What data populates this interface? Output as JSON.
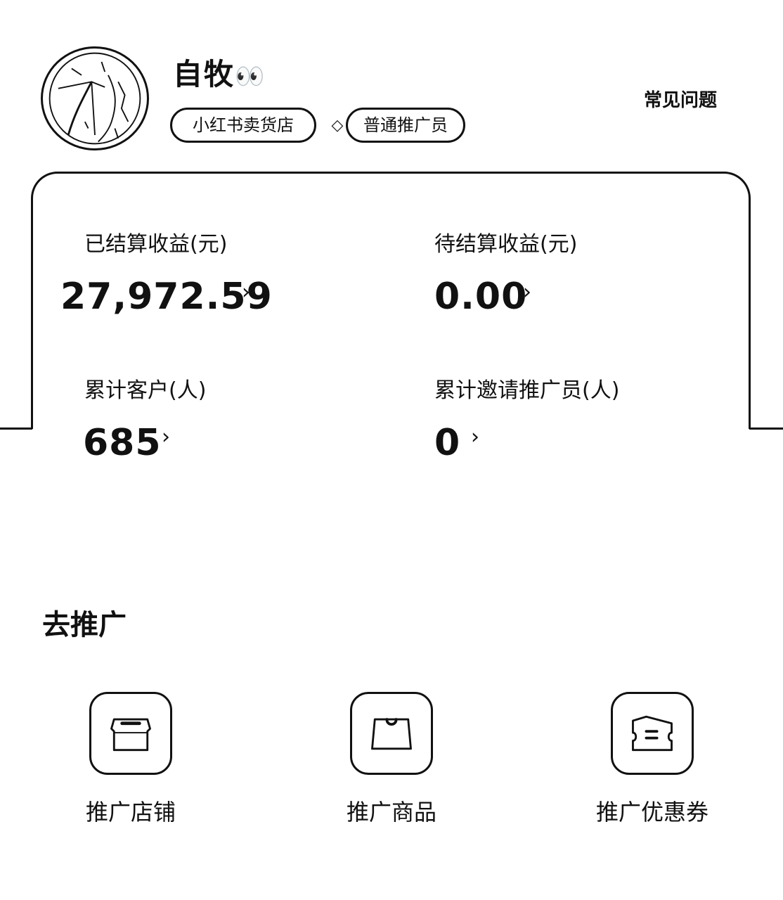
{
  "header": {
    "username": "自牧",
    "username_emoji": "👀",
    "tags": {
      "store": "小红书卖货店",
      "role": "普通推广员"
    },
    "faq_label": "常见问题"
  },
  "stats": {
    "settled_income": {
      "label": "已结算收益(元)",
      "value": "27,972.59"
    },
    "pending_income": {
      "label": "待结算收益(元)",
      "value": "0.00"
    },
    "total_customers": {
      "label": "累计客户(人)",
      "value": "685"
    },
    "total_invited": {
      "label": "累计邀请推广员(人)",
      "value": "0"
    },
    "chevron": "›"
  },
  "promote": {
    "title": "去推广",
    "items": [
      {
        "label": "推广店铺",
        "icon": "store-icon"
      },
      {
        "label": "推广商品",
        "icon": "shopping-bag-icon"
      },
      {
        "label": "推广优惠券",
        "icon": "coupon-icon"
      }
    ]
  }
}
